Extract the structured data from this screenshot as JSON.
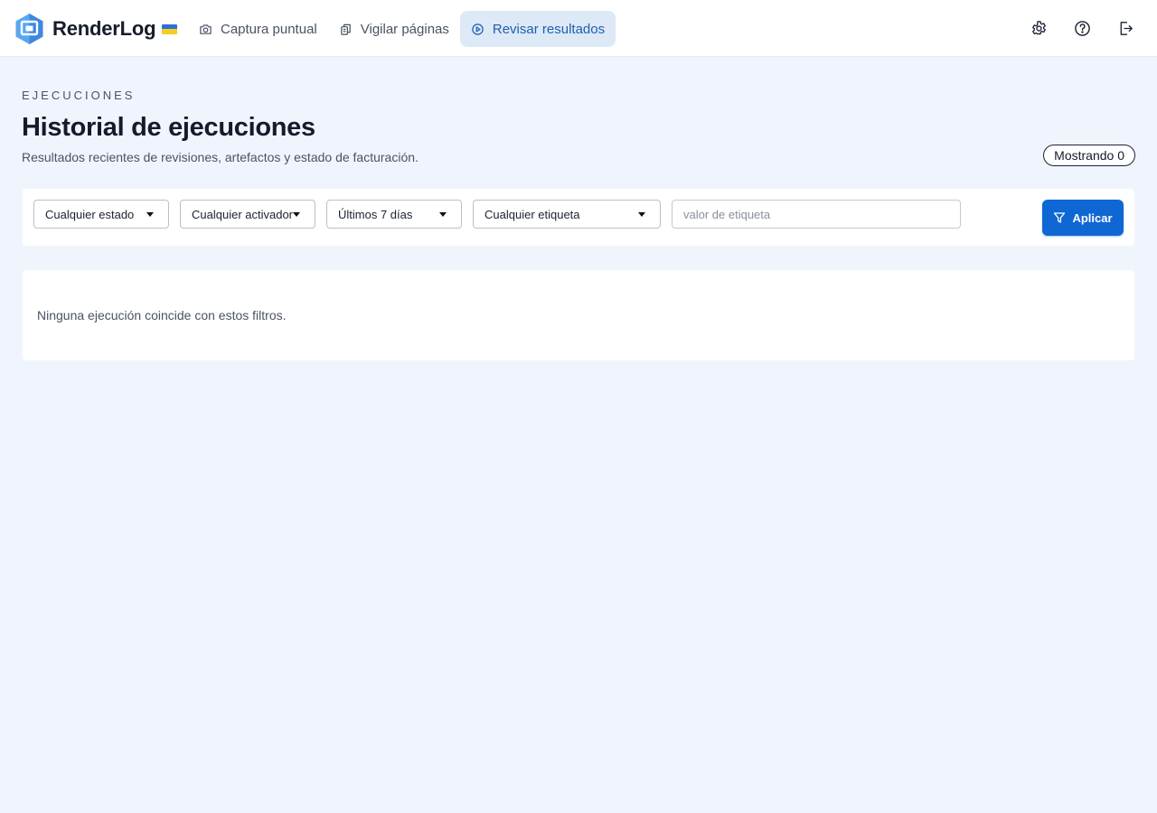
{
  "app": {
    "name": "RenderLog"
  },
  "nav": {
    "items": [
      {
        "label": "Captura puntual",
        "icon": "camera-icon",
        "active": false
      },
      {
        "label": "Vigilar páginas",
        "icon": "pages-icon",
        "active": false
      },
      {
        "label": "Revisar resultados",
        "icon": "play-circle-icon",
        "active": true
      }
    ]
  },
  "header_icons": [
    "gear-icon",
    "help-icon",
    "logout-icon"
  ],
  "page": {
    "eyebrow": "EJECUCIONES",
    "title": "Historial de ejecuciones",
    "subtitle": "Resultados recientes de revisiones, artefactos y estado de facturación.",
    "count_label": "Mostrando 0"
  },
  "filters": {
    "status": "Cualquier estado",
    "trigger": "Cualquier activador",
    "range": "Últimos 7 días",
    "tag": "Cualquier etiqueta",
    "tag_value_placeholder": "valor de etiqueta",
    "tag_value": "",
    "apply_label": "Aplicar"
  },
  "results": {
    "empty_message": "Ninguna ejecución coincide con estos filtros."
  },
  "colors": {
    "accent": "#0f67d4",
    "nav_active_bg": "#dde9f7",
    "nav_active_text": "#1f5fae",
    "page_bg": "#f0f5fd",
    "flag_top": "#2f6fd8",
    "flag_bottom": "#f6cf1c"
  }
}
